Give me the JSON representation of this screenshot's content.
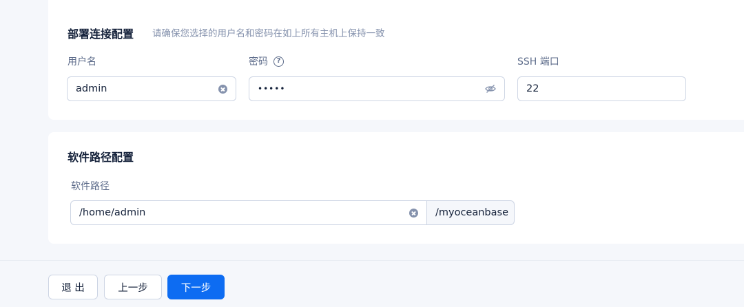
{
  "deploy_config": {
    "title": "部署连接配置",
    "hint": "请确保您选择的用户名和密码在如上所有主机上保持一致",
    "username": {
      "label": "用户名",
      "value": "admin"
    },
    "password": {
      "label": "密码",
      "value": "•••••"
    },
    "ssh_port": {
      "label": "SSH 端口",
      "value": "22"
    }
  },
  "software_config": {
    "title": "软件路径配置",
    "path": {
      "label": "软件路径",
      "value": "/home/admin",
      "suffix": "/myoceanbase"
    }
  },
  "footer": {
    "exit_label": "退 出",
    "prev_label": "上一步",
    "next_label": "下一步"
  },
  "icons": {
    "password_help": "question-circle-icon",
    "clear": "close-circle-icon",
    "password_visibility": "eye-invisible-icon"
  },
  "colors": {
    "primary": "#0d6cf2",
    "background": "#f5f7fb",
    "card": "#ffffff",
    "text": "#132039",
    "label": "#5c6b8a",
    "hint": "#8592ad",
    "border": "#cdd5e4"
  }
}
